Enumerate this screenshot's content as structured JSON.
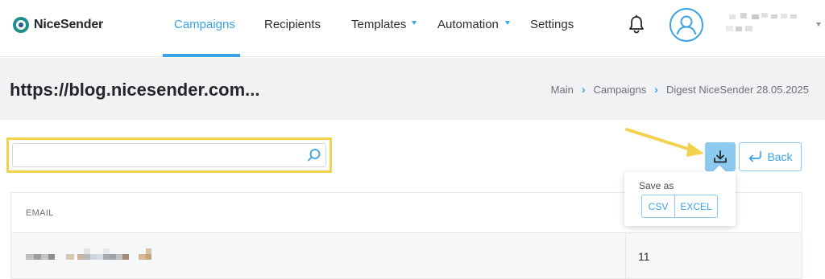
{
  "brand": {
    "name": "NiceSender"
  },
  "nav": {
    "items": [
      {
        "label": "Campaigns",
        "active": true
      },
      {
        "label": "Recipients"
      },
      {
        "label": "Templates",
        "has_dropdown": true
      },
      {
        "label": "Automation",
        "has_dropdown": true
      },
      {
        "label": "Settings"
      }
    ]
  },
  "header": {
    "title": "https://blog.nicesender.com...",
    "breadcrumb": [
      "Main",
      "Campaigns",
      "Digest NiceSender 28.05.2025"
    ]
  },
  "search": {
    "value": "",
    "placeholder": ""
  },
  "actions": {
    "back_label": "Back",
    "save_as": {
      "label": "Save as",
      "options": [
        "CSV",
        "EXCEL"
      ]
    }
  },
  "table": {
    "columns": [
      "EMAIL"
    ],
    "rows": [
      {
        "email": "",
        "value": "11"
      }
    ]
  },
  "colors": {
    "accent": "#3aa3e3",
    "accent_light": "#8dcaf0",
    "highlight": "#f2d14f",
    "header_bg": "#f1f2f4"
  }
}
